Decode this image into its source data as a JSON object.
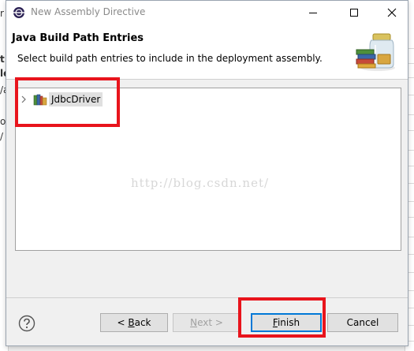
{
  "dialog": {
    "title": "New Assembly Directive",
    "header_title": "Java Build Path Entries",
    "header_description": "Select build path entries to include in the deployment assembly."
  },
  "tree": {
    "items": [
      {
        "label": "JdbcDriver",
        "icon": "library-icon",
        "expanded": false
      }
    ]
  },
  "watermark": "http://blog.csdn.net/",
  "buttons": {
    "back": {
      "prefix": "< ",
      "mnemonic": "B",
      "rest": "ack"
    },
    "next": {
      "mnemonic": "N",
      "rest": "ext >"
    },
    "finish": {
      "mnemonic": "F",
      "rest": "inish"
    },
    "cancel": "Cancel"
  },
  "background_fragments": [
    "r",
    "t",
    "le",
    "/a",
    "or",
    "/"
  ],
  "colors": {
    "highlight_box": "#e8141c",
    "default_button_border": "#0078d7",
    "selection_bg": "#e0e0e0"
  }
}
